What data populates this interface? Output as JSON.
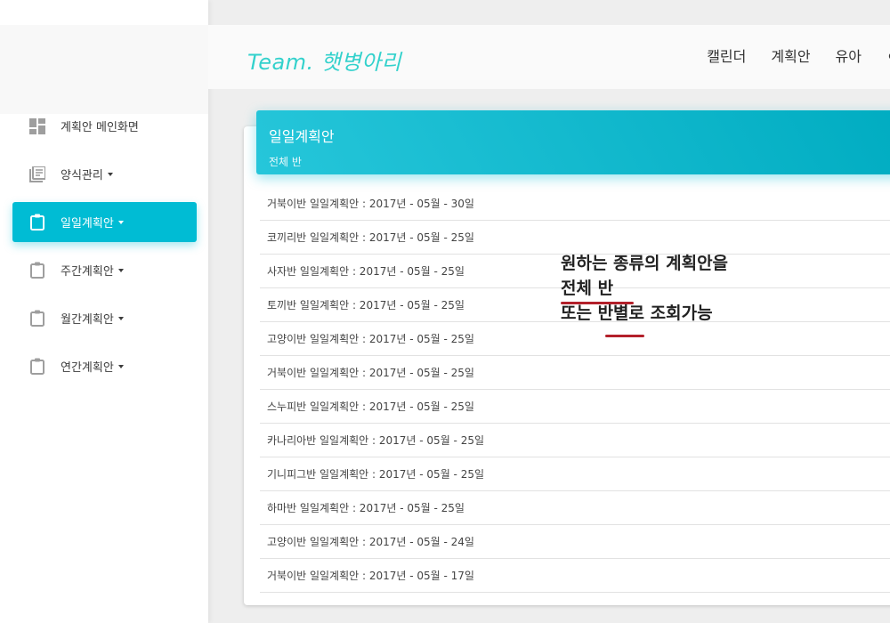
{
  "header": {
    "brand": "Team. 햇병아리",
    "nav": [
      "캘린더",
      "계획안",
      "유아"
    ]
  },
  "sidebar": {
    "items": [
      {
        "label": "계획안 메인화면",
        "icon": "dashboard-icon",
        "caret": false,
        "active": false
      },
      {
        "label": "양식관리",
        "icon": "library-books-icon",
        "caret": true,
        "active": false
      },
      {
        "label": "일일계획안",
        "icon": "clipboard-icon",
        "caret": true,
        "active": true
      },
      {
        "label": "주간계획안",
        "icon": "clipboard-icon",
        "caret": true,
        "active": false
      },
      {
        "label": "월간계획안",
        "icon": "clipboard-icon",
        "caret": true,
        "active": false
      },
      {
        "label": "연간계획안",
        "icon": "clipboard-icon",
        "caret": true,
        "active": false
      }
    ]
  },
  "card": {
    "title": "일일계획안",
    "subtitle": "전체 반",
    "rows": [
      "거북이반 일일계획안 : 2017년 - 05월 - 30일",
      "코끼리반 일일계획안 : 2017년 - 05월 - 25일",
      "사자반 일일계획안 : 2017년 - 05월 - 25일",
      "토끼반 일일계획안 : 2017년 - 05월 - 25일",
      "고양이반 일일계획안 : 2017년 - 05월 - 25일",
      "거북이반 일일계획안 : 2017년 - 05월 - 25일",
      "스누피반 일일계획안 : 2017년 - 05월 - 25일",
      "카나리아반 일일계획안 : 2017년 - 05월 - 25일",
      "기니피그반 일일계획안 : 2017년 - 05월 - 25일",
      "하마반 일일계획안 : 2017년 - 05월 - 25일",
      "고양이반 일일계획안 : 2017년 - 05월 - 24일",
      "거북이반 일일계획안 : 2017년 - 05월 - 17일"
    ]
  },
  "annotation": {
    "line1": "원하는 종류의 계획안을",
    "line2": "전체 반",
    "line3": "또는 반별로 조회가능"
  },
  "colors": {
    "accent": "#00bcd4",
    "brand": "#33d1cc",
    "underline": "#b3202a"
  }
}
